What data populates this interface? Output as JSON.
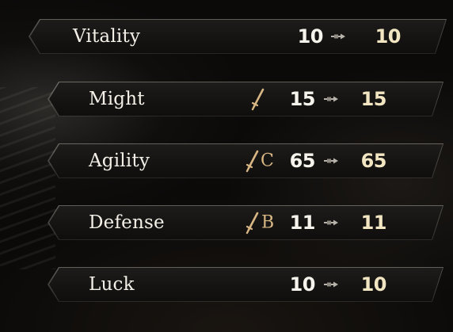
{
  "stats": [
    {
      "name": "Vitality",
      "scaling": "",
      "grade": "",
      "current": "10",
      "next": "10",
      "arrow_icon": "arrow-right-icon"
    },
    {
      "name": "Might",
      "scaling": "sword-scaling-icon",
      "grade": "",
      "current": "15",
      "next": "15",
      "arrow_icon": "arrow-right-icon"
    },
    {
      "name": "Agility",
      "scaling": "sword-scaling-icon",
      "grade": "C",
      "current": "65",
      "next": "65",
      "arrow_icon": "arrow-right-icon"
    },
    {
      "name": "Defense",
      "scaling": "sword-scaling-icon",
      "grade": "B",
      "current": "11",
      "next": "11",
      "arrow_icon": "arrow-right-icon"
    },
    {
      "name": "Luck",
      "scaling": "",
      "grade": "",
      "current": "10",
      "next": "10",
      "arrow_icon": "arrow-right-icon"
    }
  ],
  "colors": {
    "text": "#f4f0e8",
    "next_value": "#f2e5c2",
    "grade": "#d8b784",
    "plate": "#151413"
  }
}
